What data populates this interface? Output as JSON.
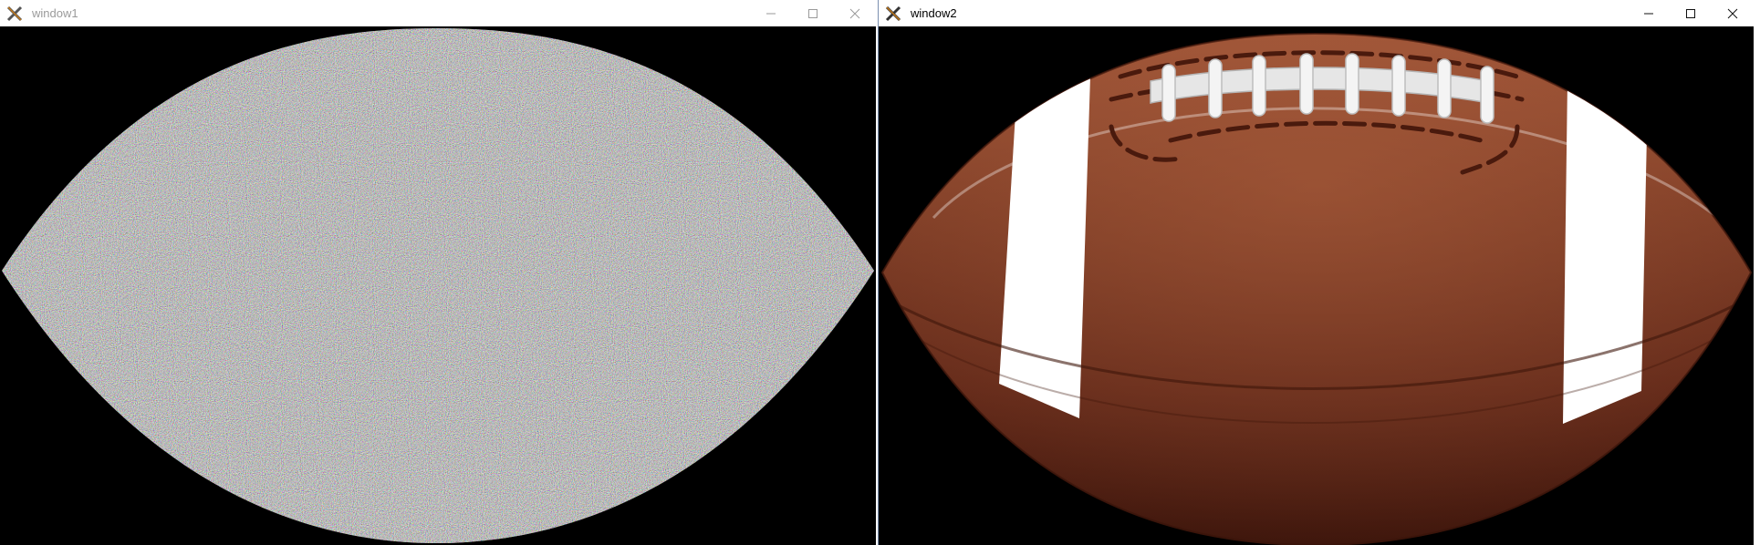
{
  "window1": {
    "title": "window1",
    "icon": "x-server-icon",
    "controls": [
      "minimize-icon",
      "maximize-icon",
      "close-icon"
    ],
    "content": "noise-filled-football-shape"
  },
  "window2": {
    "title": "window2",
    "icon": "x-server-icon",
    "controls": [
      "minimize-icon",
      "maximize-icon",
      "close-icon"
    ],
    "content": "american-football-image"
  },
  "colors": {
    "background": "#000000",
    "titlebar": "#ffffff",
    "inactive_title": "#9a9a9a",
    "active_title": "#000000",
    "football_brown": "#6b2e1c",
    "stripe": "#ffffff",
    "laces": "#e8e8e8"
  }
}
